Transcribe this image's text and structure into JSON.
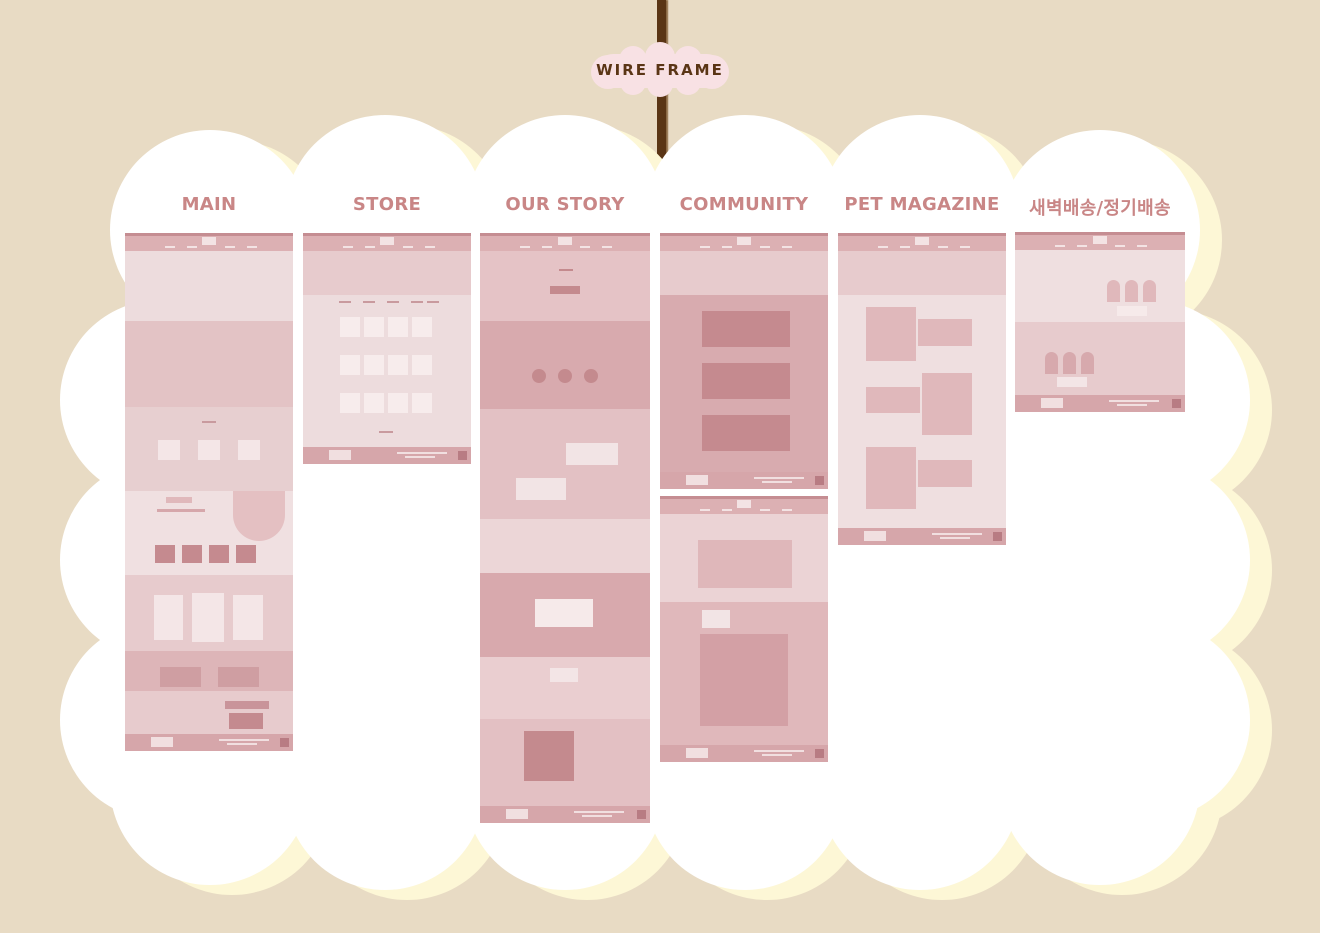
{
  "badge": {
    "label": "WIRE FRAME"
  },
  "columns": [
    {
      "title": "MAIN"
    },
    {
      "title": "STORE"
    },
    {
      "title": "OUR STORY"
    },
    {
      "title": "COMMUNITY"
    },
    {
      "title": "PET MAGAZINE"
    },
    {
      "title": "새벽배송/정기배송"
    }
  ],
  "colors": {
    "background": "#e8dbc4",
    "cloud": "#ffffff",
    "cloud_shadow": "#fdf7d6",
    "title": "#c98686",
    "wire_light": "#efdfe0",
    "wire_mid": "#e4c6c8",
    "wire_dark": "#d7a9ad",
    "accent": "#c48a8e",
    "string": "#5a3515"
  }
}
